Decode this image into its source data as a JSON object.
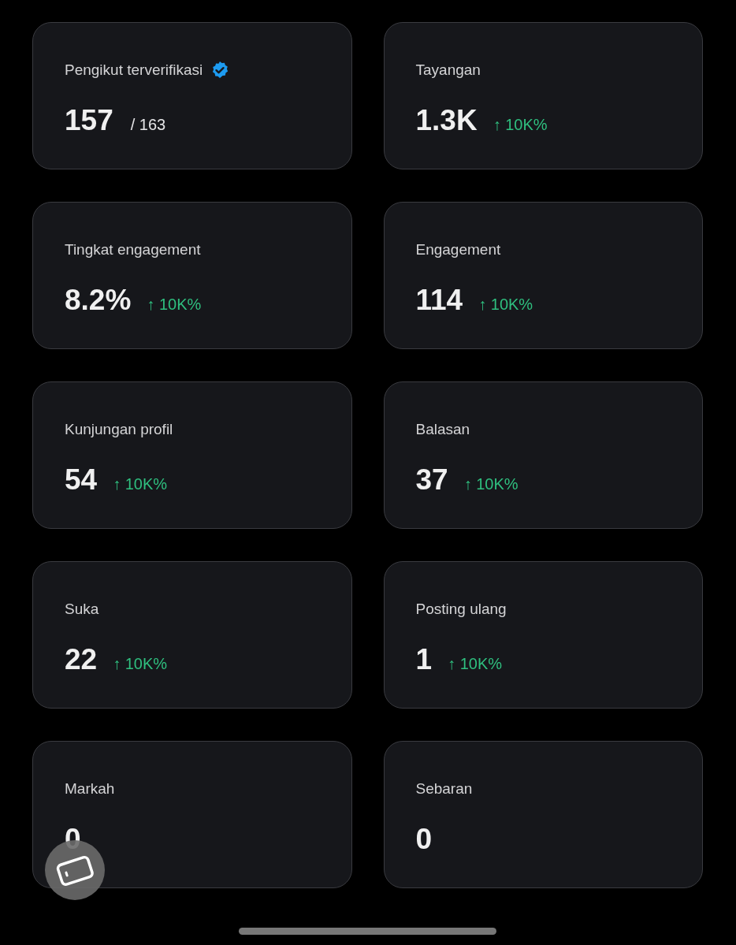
{
  "cards": [
    {
      "label": "Pengikut terverifikasi",
      "verified": true,
      "value": "157",
      "total": "/ 163"
    },
    {
      "label": "Tayangan",
      "verified": false,
      "value": "1.3K",
      "change": "↑ 10K%"
    },
    {
      "label": "Tingkat engagement",
      "verified": false,
      "value": "8.2%",
      "change": "↑ 10K%"
    },
    {
      "label": "Engagement",
      "verified": false,
      "value": "114",
      "change": "↑ 10K%"
    },
    {
      "label": "Kunjungan profil",
      "verified": false,
      "value": "54",
      "change": "↑ 10K%"
    },
    {
      "label": "Balasan",
      "verified": false,
      "value": "37",
      "change": "↑ 10K%"
    },
    {
      "label": "Suka",
      "verified": false,
      "value": "22",
      "change": "↑ 10K%"
    },
    {
      "label": "Posting ulang",
      "verified": false,
      "value": "1",
      "change": "↑ 10K%"
    },
    {
      "label": "Markah",
      "verified": false,
      "value": "0"
    },
    {
      "label": "Sebaran",
      "verified": false,
      "value": "0"
    }
  ]
}
